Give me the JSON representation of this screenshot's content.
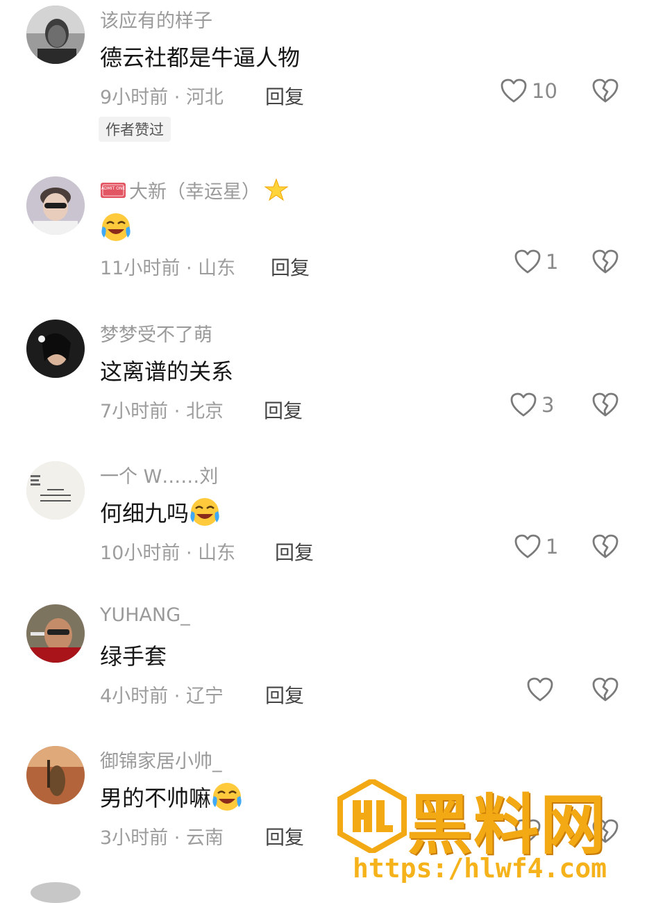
{
  "comments": [
    {
      "username": "该应有的样子",
      "content": "德云社都是牛逼人物",
      "time": "9小时前",
      "location": "河北",
      "reply": "回复",
      "likes": "10",
      "tag": "作者赞过"
    },
    {
      "username": "大新（幸运星）",
      "badge": "ADMIT ONE",
      "content": "",
      "time": "11小时前",
      "location": "山东",
      "reply": "回复",
      "likes": "1"
    },
    {
      "username": "梦梦受不了萌",
      "content": "这离谱的关系",
      "time": "7小时前",
      "location": "北京",
      "reply": "回复",
      "likes": "3"
    },
    {
      "username": "一个 W……刘",
      "content": "何细九吗",
      "time": "10小时前",
      "location": "山东",
      "reply": "回复",
      "likes": "1"
    },
    {
      "username": "YUHANG_",
      "content": "绿手套",
      "time": "4小时前",
      "location": "辽宁",
      "reply": "回复",
      "likes": ""
    },
    {
      "username": "御锦家居小帅_",
      "content": "男的不帅嘛",
      "time": "3小时前",
      "location": "云南",
      "reply": "回复",
      "likes": ""
    }
  ],
  "meta_separator": " · ",
  "watermark": {
    "title": "黑料网",
    "url": "https:/hlwf4.com"
  },
  "icons": {
    "like": "heart-outline-icon",
    "dislike": "broken-heart-icon",
    "emoji": "crying-laughing-emoji",
    "badge": "admit-one-ticket-icon",
    "star": "glowing-star-icon"
  },
  "colors": {
    "watermark": "#f3a913",
    "text": "#161616",
    "secondary": "#9d9d9d"
  }
}
